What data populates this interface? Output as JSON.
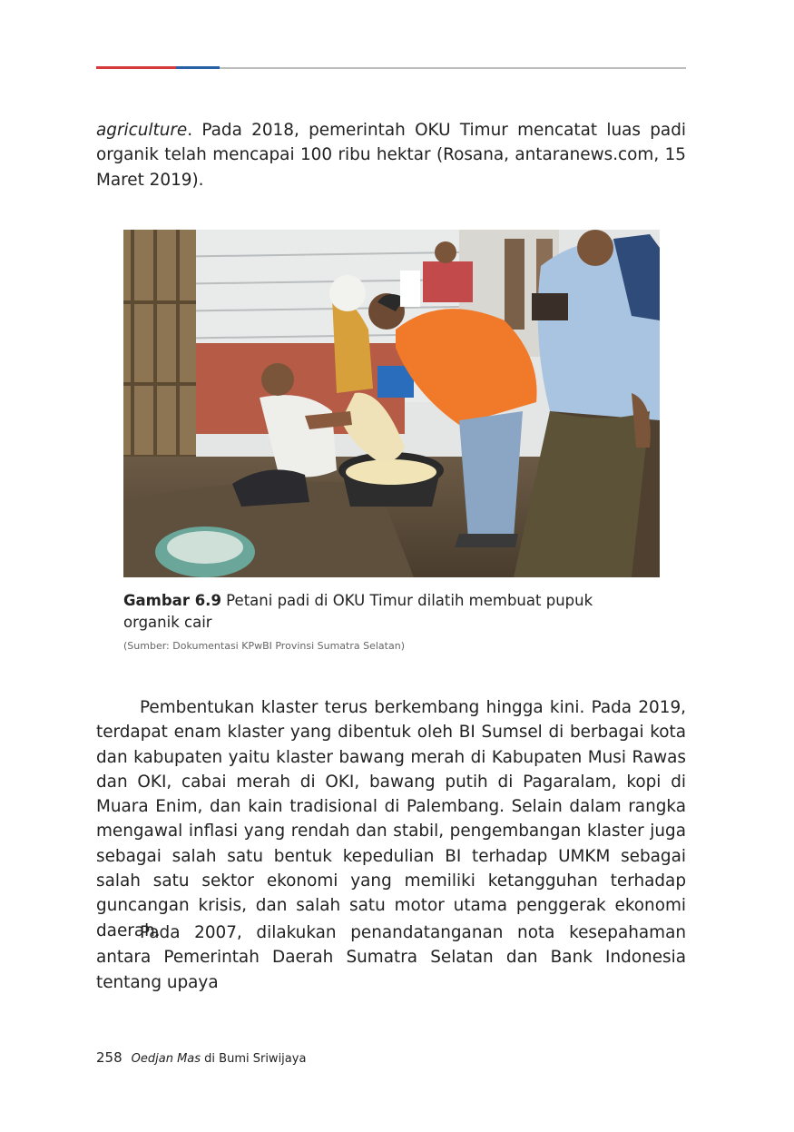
{
  "colors": {
    "rule_red": "#d63a3a",
    "rule_blue": "#2860a8",
    "rule_gray": "#bdbdbd"
  },
  "paragraph1": {
    "italic": "agriculture",
    "rest": ". Pada 2018, pemerintah OKU Timur mencatat luas padi organik telah mencapai 100 ribu hektar (Rosana, antaranews.com, 15 Maret 2019)."
  },
  "figure": {
    "label": "Gambar 6.9",
    "caption": " Petani padi di OKU Timur dilatih membuat pupuk organik cair",
    "source": "(Sumber: Dokumentasi KPwBI Provinsi Sumatra Selatan)"
  },
  "paragraph2": "Pembentukan klaster terus berkembang hingga kini. Pada 2019, terdapat enam klaster yang dibentuk oleh BI Sumsel di berbagai kota dan kabupaten yaitu klaster bawang merah di Kabupaten Musi Rawas dan OKI, cabai merah di OKI, bawang putih di Pagaralam, kopi di Muara Enim, dan kain tradisional di Palembang. Selain dalam rangka mengawal inflasi yang rendah dan stabil, pengembangan klaster juga sebagai salah satu bentuk kepedulian BI terhadap UMKM sebagai salah satu sektor ekonomi yang memiliki ketangguhan terhadap guncangan krisis, dan salah satu motor utama penggerak ekonomi daerah.",
  "paragraph3": "Pada 2007, dilakukan penandatanganan nota kesepahaman antara Pemerintah Daerah Sumatra Selatan dan Bank Indonesia tentang upaya",
  "footer": {
    "page_number": "258",
    "book_title_italic": "Oedjan Mas",
    "book_title_rest": " di Bumi Sriwijaya"
  }
}
